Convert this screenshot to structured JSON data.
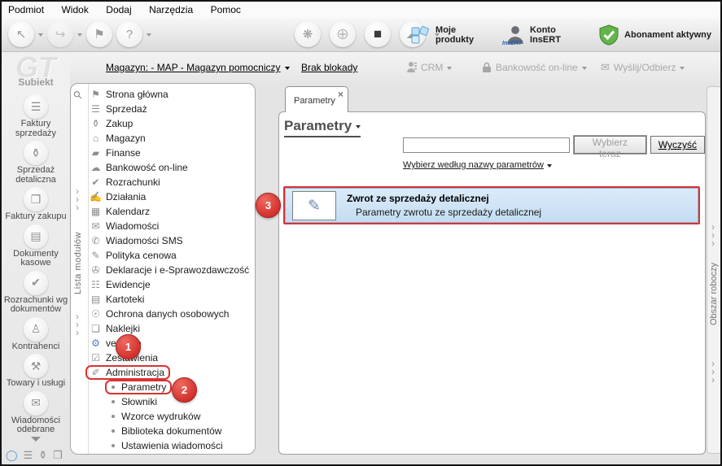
{
  "menu_bar": {
    "items": [
      {
        "label": "Podmiot"
      },
      {
        "label": "Widok"
      },
      {
        "label": "Dodaj"
      },
      {
        "label": "Narzędzia"
      },
      {
        "label": "Pomoc"
      }
    ]
  },
  "toolbar": {
    "account_icon_text": "InsERT",
    "right_items_labels": {
      "products": "Moje produkty",
      "account": "Konto InsERT",
      "subscription": "Abonament aktywny"
    }
  },
  "subtoolbar": {
    "warehouse_link": "Magazyn: - MAP - Magazyn pomocniczy",
    "lock_status_link": "Brak blokady",
    "crm": "CRM",
    "banking": "Bankowość on-line",
    "send_receive": "Wyślij/Odbierz"
  },
  "sidebar": {
    "watermark": "GT",
    "app_name": "Subiekt",
    "modules": [
      {
        "icon": "sales-invoices-icon",
        "label": "Faktury sprzedaży"
      },
      {
        "icon": "retail-sales-icon",
        "label": "Sprzedaż detaliczna"
      },
      {
        "icon": "purchase-invoices-icon",
        "label": "Faktury zakupu"
      },
      {
        "icon": "cash-documents-icon",
        "label": "Dokumenty kasowe"
      },
      {
        "icon": "doc-settlements-icon",
        "label": "Rozrachunki wg dokumentów"
      },
      {
        "icon": "contractors-icon",
        "label": "Kontrahenci"
      },
      {
        "icon": "goods-icon",
        "label": "Towary i usługi"
      },
      {
        "icon": "inbox-icon",
        "label": "Wiadomości odebrane"
      }
    ]
  },
  "modules_panel": {
    "vertical_label": "Lista modułów",
    "items": [
      {
        "icon": "home-flag-icon",
        "label": "Strona główna"
      },
      {
        "icon": "coins-icon",
        "label": "Sprzedaż"
      },
      {
        "icon": "basket-icon",
        "label": "Zakup"
      },
      {
        "icon": "warehouse-icon",
        "label": "Magazyn"
      },
      {
        "icon": "wallet-icon",
        "label": "Finanse"
      },
      {
        "icon": "banking-online-icon",
        "label": "Bankowość on-line"
      },
      {
        "icon": "settlements-icon",
        "label": "Rozrachunki"
      },
      {
        "icon": "actions-icon",
        "label": "Działania"
      },
      {
        "icon": "calendar-icon",
        "label": "Kalendarz"
      },
      {
        "icon": "mail-icon",
        "label": "Wiadomości"
      },
      {
        "icon": "sms-icon",
        "label": "Wiadomości SMS"
      },
      {
        "icon": "pricing-icon",
        "label": "Polityka cenowa"
      },
      {
        "icon": "declarations-icon",
        "label": "Deklaracje i e-Sprawozdawczość"
      },
      {
        "icon": "records-icon",
        "label": "Ewidencje"
      },
      {
        "icon": "cards-icon",
        "label": "Kartoteki"
      },
      {
        "icon": "privacy-shield-icon",
        "label": "Ochrona danych osobowych"
      },
      {
        "icon": "labels-icon",
        "label": "Naklejki"
      },
      {
        "icon": "gear-icon",
        "label": "vendero",
        "class": "accent"
      },
      {
        "icon": "reports-icon",
        "label": "Zestawienia"
      },
      {
        "icon": "admin-icon",
        "label": "Administracja",
        "class": "step-outline"
      },
      {
        "label": "Parametry",
        "class": "sub step-outline"
      },
      {
        "label": "Słowniki",
        "class": "sub"
      },
      {
        "label": "Wzorce wydruków",
        "class": "sub"
      },
      {
        "label": "Biblioteka dokumentów",
        "class": "sub"
      },
      {
        "label": "Ustawienia wiadomości",
        "class": "sub"
      }
    ]
  },
  "main": {
    "tab_label": "Parametry",
    "title": "Parametry",
    "search": {
      "value": "",
      "choose_button": "Wybierz teraz",
      "clear_button": "Wyczyść",
      "filter_link": "Wybierz według nazwy parametrów"
    },
    "result": {
      "title": "Zwrot ze sprzedaży detalicznej",
      "subtitle": "Parametry zwrotu ze sprzedaży detalicznej"
    }
  },
  "workspace_strip": {
    "label": "Obszar roboczy"
  },
  "annotations": {
    "steps": [
      "1",
      "2",
      "3"
    ]
  },
  "colors": {
    "annotation_red": "#d93232",
    "highlight_blue": "#cfe4f7",
    "accent_blue": "#4c7fc0",
    "subscription_green": "#63b54b"
  },
  "icon_glyphs": {
    "select-arrow-icon": "↖",
    "forward-arrow-icon": "↪",
    "flag-icon": "⚑",
    "help-icon": "?",
    "sync-dots-icon": "❋",
    "globe-icon": "⊕",
    "cube-icon": "■",
    "cloud-icon": "☁",
    "magnifier-icon": "⚲",
    "chevron-right-icon": "›",
    "close-icon": "×",
    "result-doc-icon": "✎",
    "mail-icon": "✉",
    "home-flag-icon": "⚑",
    "coins-icon": "☰",
    "basket-icon": "⚱",
    "warehouse-icon": "⌂",
    "wallet-icon": "▰",
    "banking-online-icon": "☁",
    "settlements-icon": "✔",
    "actions-icon": "✍",
    "calendar-icon": "▦",
    "sms-icon": "✆",
    "pricing-icon": "✎",
    "declarations-icon": "✇",
    "records-icon": "☷",
    "cards-icon": "▤",
    "privacy-shield-icon": "☉",
    "labels-icon": "❏",
    "gear-icon": "⚙",
    "reports-icon": "☑",
    "admin-icon": "✐",
    "sales-invoices-icon": "☰",
    "retail-sales-icon": "⚱",
    "purchase-invoices-icon": "❒",
    "cash-documents-icon": "▤",
    "doc-settlements-icon": "✔",
    "contractors-icon": "♙",
    "goods-icon": "⚒",
    "inbox-icon": "✉",
    "view-home-icon": "◯",
    "view-coins-icon": "☰",
    "view-basket-icon": "⚱",
    "view-box-icon": "❒"
  }
}
